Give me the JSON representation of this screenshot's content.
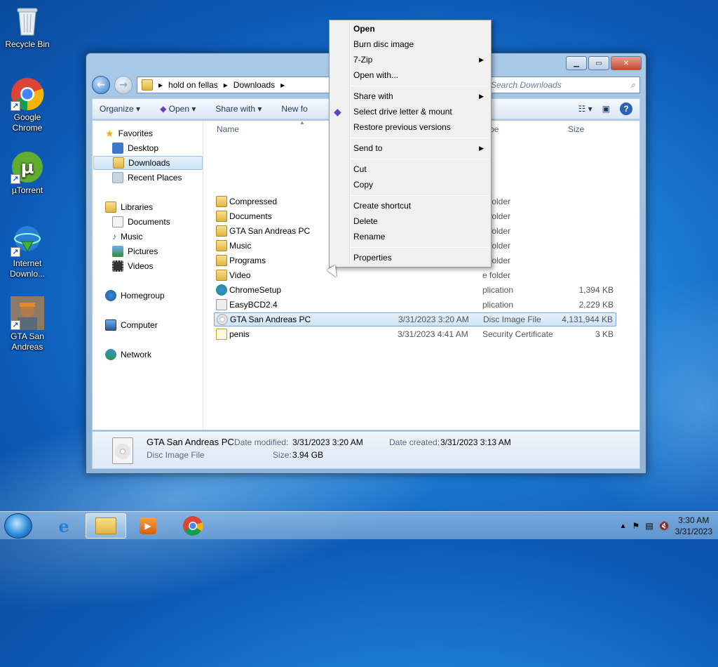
{
  "desktop": {
    "icons": [
      {
        "label": "Recycle Bin"
      },
      {
        "label": "Google Chrome"
      },
      {
        "label": "µTorrent"
      },
      {
        "label": "Internet Downlo..."
      },
      {
        "label": "GTA San Andreas"
      }
    ]
  },
  "window": {
    "address": {
      "segments": [
        "hold on fellas",
        "Downloads"
      ]
    },
    "search_placeholder": "Search Downloads",
    "toolbar": {
      "organize": "Organize",
      "open": "Open",
      "share_with": "Share with",
      "new_folder": "New fo"
    },
    "nav": {
      "favorites": "Favorites",
      "desktop": "Desktop",
      "downloads": "Downloads",
      "recent": "Recent Places",
      "libraries": "Libraries",
      "documents": "Documents",
      "music": "Music",
      "pictures": "Pictures",
      "videos": "Videos",
      "homegroup": "Homegroup",
      "computer": "Computer",
      "network": "Network"
    },
    "columns": {
      "name": "Name",
      "type": "pe",
      "size": "Size"
    },
    "files": [
      {
        "name": "Compressed",
        "date": "",
        "type": "e folder",
        "size": ""
      },
      {
        "name": "Documents",
        "date": "",
        "type": "e folder",
        "size": ""
      },
      {
        "name": "GTA San Andreas PC",
        "date": "",
        "type": "e folder",
        "size": ""
      },
      {
        "name": "Music",
        "date": "",
        "type": "e folder",
        "size": ""
      },
      {
        "name": "Programs",
        "date": "",
        "type": "e folder",
        "size": ""
      },
      {
        "name": "Video",
        "date": "",
        "type": "e folder",
        "size": ""
      },
      {
        "name": "ChromeSetup",
        "date": "",
        "type": "plication",
        "size": "1,394 KB"
      },
      {
        "name": "EasyBCD2.4",
        "date": "",
        "type": "plication",
        "size": "2,229 KB"
      },
      {
        "name": "GTA San Andreas PC",
        "date": "3/31/2023 3:20 AM",
        "type": "Disc Image File",
        "size": "4,131,944 KB"
      },
      {
        "name": "penis",
        "date": "3/31/2023 4:41 AM",
        "type": "Security Certificate",
        "size": "3 KB"
      }
    ],
    "details": {
      "name": "GTA San Andreas PC",
      "kind": "Disc Image File",
      "date_modified_label": "Date modified:",
      "date_modified": "3/31/2023 3:20 AM",
      "date_created_label": "Date created:",
      "date_created": "3/31/2023 3:13 AM",
      "size_label": "Size:",
      "size": "3.94 GB"
    }
  },
  "context_menu": {
    "open": "Open",
    "burn": "Burn disc image",
    "zip": "7-Zip",
    "open_with": "Open with...",
    "share_with": "Share with",
    "mount": "Select drive letter & mount",
    "restore": "Restore previous versions",
    "send_to": "Send to",
    "cut": "Cut",
    "copy": "Copy",
    "shortcut": "Create shortcut",
    "delete": "Delete",
    "rename": "Rename",
    "properties": "Properties"
  },
  "taskbar": {
    "time": "3:30 AM",
    "date": "3/31/2023"
  }
}
